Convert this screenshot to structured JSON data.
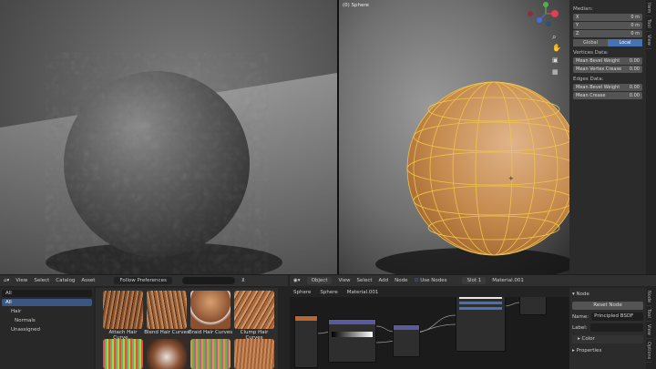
{
  "viewport_right": {
    "title": "(0) Sphere"
  },
  "npanel": {
    "median_label": "Median:",
    "median": [
      {
        "axis": "X",
        "value": "0 m"
      },
      {
        "axis": "Y",
        "value": "0 m"
      },
      {
        "axis": "Z",
        "value": "0 m"
      }
    ],
    "space_global": "Global",
    "space_local": "Local",
    "vertices_label": "Vertices Data:",
    "vertex_fields": [
      {
        "name": "Mean Bevel Weight",
        "value": "0.00"
      },
      {
        "name": "Mean Vertex Crease",
        "value": "0.00"
      }
    ],
    "edges_label": "Edges Data:",
    "edge_fields": [
      {
        "name": "Mean Bevel Weight",
        "value": "0.00"
      },
      {
        "name": "Mean Crease",
        "value": "0.00"
      }
    ],
    "tabs": [
      "Item",
      "Tool",
      "View"
    ]
  },
  "asset_browser": {
    "menu": [
      "View",
      "Select",
      "Catalog",
      "Asset"
    ],
    "library": "Follow Preferences",
    "filter": "All",
    "catalogs": [
      "All",
      "Hair",
      "Normals",
      "Unassigned"
    ],
    "assets": [
      "Attach Hair Curve...",
      "Blend Hair Curves",
      "Braid Hair Curves",
      "Clump Hair Curves"
    ]
  },
  "node_editor": {
    "mode": "Object",
    "menu": [
      "View",
      "Select",
      "Add",
      "Node"
    ],
    "use_nodes": "Use Nodes",
    "slot": "Slot 1",
    "material": "Material.001",
    "breadcrumb": [
      "Sphere",
      "Sphere",
      "Material.001"
    ]
  },
  "properties": {
    "section": "Node",
    "reset_node": "Reset Node",
    "name_label": "Name:",
    "name_value": "Principled BSDF",
    "label_label": "Label:",
    "color": "Color",
    "properties": "Properties",
    "tabs": [
      "Node",
      "Tool",
      "View",
      "Options"
    ]
  }
}
